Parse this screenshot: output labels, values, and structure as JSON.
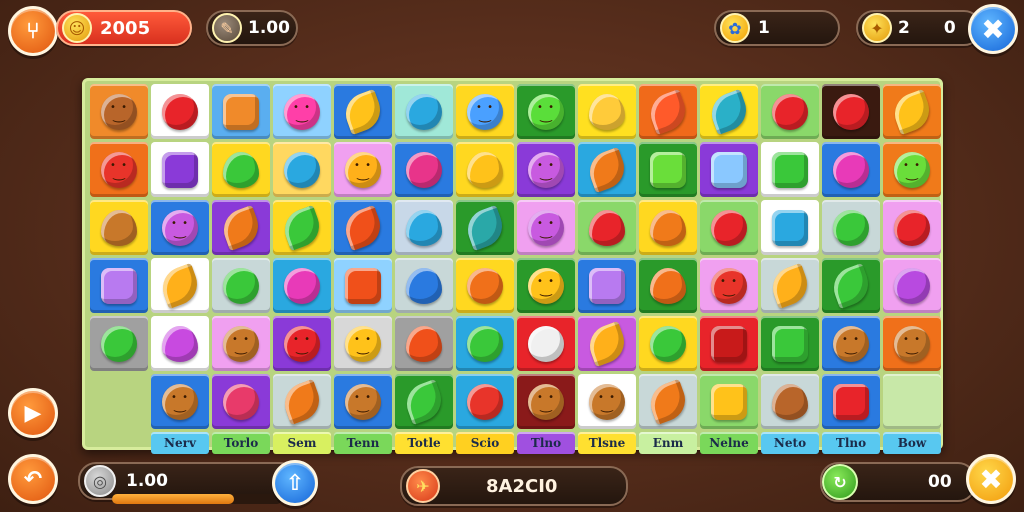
{
  "hud": {
    "score": "2005",
    "boosters": "1.00",
    "lives": "1",
    "coins_left": "2",
    "coins_right": "0",
    "bottom_left_value": "1.00",
    "center_code": "8A2CI0",
    "bottom_right_value": "00",
    "progress_fraction": 0.72
  },
  "colors": {
    "accent": "#e0560f",
    "board_border": "#d7ec9c",
    "background": "#5a2f1d"
  },
  "icons": {
    "top_left": "menu-icon",
    "score": "coin-face-icon",
    "booster": "pencil-icon",
    "lives": "paw-icon",
    "coins": "coin-icon",
    "close": "close-x-icon",
    "play": "play-icon",
    "back": "back-arrow-icon",
    "shield": "shield-icon",
    "upload": "upload-icon",
    "center": "rocket-icon",
    "refresh": "refresh-icon",
    "bottom_close": "close-x-icon"
  },
  "board": {
    "rows": [
      [
        {
          "bg": "#f08a2a",
          "color": "#b8652a",
          "shape": "face"
        },
        {
          "bg": "#ffffff",
          "color": "#e8242a",
          "shape": "round"
        },
        {
          "bg": "#5aaef0",
          "color": "#f08a2a",
          "shape": "sq"
        },
        {
          "bg": "#8fd2ff",
          "color": "#ff3fa8",
          "shape": "face"
        },
        {
          "bg": "#2a7ae0",
          "color": "#ffc21a",
          "shape": "leaf"
        },
        {
          "bg": "#a0e8d8",
          "color": "#2aa8e0",
          "shape": "round"
        },
        {
          "bg": "#ffd820",
          "color": "#4aa0ff",
          "shape": "face"
        },
        {
          "bg": "#2a9a2a",
          "color": "#5ade3a",
          "shape": "face"
        },
        {
          "bg": "#ffe020",
          "color": "#ffcb3a",
          "shape": "drop"
        },
        {
          "bg": "#f06a1a",
          "color": "#ff5a2a",
          "shape": "leaf"
        },
        {
          "bg": "#ffe020",
          "color": "#2ab0c8",
          "shape": "leaf"
        },
        {
          "bg": "#8ad86a",
          "color": "#e8242a",
          "shape": "round"
        },
        {
          "bg": "#3a1a10",
          "color": "#e8242a",
          "shape": "round"
        },
        {
          "bg": "#f07a1a",
          "color": "#ffc21a",
          "shape": "leaf"
        }
      ],
      [
        {
          "bg": "#f0701a",
          "color": "#e8342a",
          "shape": "face"
        },
        {
          "bg": "#ffffff",
          "color": "#8a3ad8",
          "shape": "sq"
        },
        {
          "bg": "#ffd820",
          "color": "#3ac83a",
          "shape": "drop"
        },
        {
          "bg": "#ffd860",
          "color": "#2aa8e0",
          "shape": "round"
        },
        {
          "bg": "#f0a0f0",
          "color": "#ffb01a",
          "shape": "face"
        },
        {
          "bg": "#2a7ae0",
          "color": "#e8348a",
          "shape": "round"
        },
        {
          "bg": "#ffd820",
          "color": "#ffc21a",
          "shape": "drop"
        },
        {
          "bg": "#8a3ad8",
          "color": "#c85ae0",
          "shape": "face"
        },
        {
          "bg": "#2aa8e0",
          "color": "#f07a1a",
          "shape": "leaf"
        },
        {
          "bg": "#2a9a2a",
          "color": "#6ade3a",
          "shape": "sq"
        },
        {
          "bg": "#8a3ad8",
          "color": "#8ac8ff",
          "shape": "sq"
        },
        {
          "bg": "#ffffff",
          "color": "#3ac83a",
          "shape": "sq"
        },
        {
          "bg": "#2a7ae0",
          "color": "#e83ab8",
          "shape": "round"
        },
        {
          "bg": "#f07a1a",
          "color": "#6ade3a",
          "shape": "face"
        }
      ],
      [
        {
          "bg": "#ffd820",
          "color": "#c8782a",
          "shape": "drop"
        },
        {
          "bg": "#2a7ae0",
          "color": "#c85ae0",
          "shape": "face"
        },
        {
          "bg": "#8a3ad8",
          "color": "#f07a1a",
          "shape": "leaf"
        },
        {
          "bg": "#ffd820",
          "color": "#3ac83a",
          "shape": "leaf"
        },
        {
          "bg": "#2a7ae0",
          "color": "#f0501a",
          "shape": "leaf"
        },
        {
          "bg": "#c8d8e8",
          "color": "#2aa8e0",
          "shape": "drop"
        },
        {
          "bg": "#2a9a2a",
          "color": "#2aa8a8",
          "shape": "leaf"
        },
        {
          "bg": "#f0a0f0",
          "color": "#c85ae0",
          "shape": "face"
        },
        {
          "bg": "#8ad86a",
          "color": "#e8242a",
          "shape": "drop"
        },
        {
          "bg": "#ffd820",
          "color": "#f07a1a",
          "shape": "drop"
        },
        {
          "bg": "#8ad86a",
          "color": "#e8242a",
          "shape": "round"
        },
        {
          "bg": "#ffffff",
          "color": "#2aa8e0",
          "shape": "sq"
        },
        {
          "bg": "#c8d8d8",
          "color": "#3ac83a",
          "shape": "round"
        },
        {
          "bg": "#f0a0f0",
          "color": "#e8242a",
          "shape": "round"
        }
      ],
      [
        {
          "bg": "#2a7ae0",
          "color": "#b87af0",
          "shape": "sq"
        },
        {
          "bg": "#ffffff",
          "color": "#ffb01a",
          "shape": "leaf"
        },
        {
          "bg": "#c8d8d8",
          "color": "#3ac83a",
          "shape": "round"
        },
        {
          "bg": "#2aa8e0",
          "color": "#e83ab8",
          "shape": "round"
        },
        {
          "bg": "#8fd2ff",
          "color": "#f0501a",
          "shape": "sq"
        },
        {
          "bg": "#c8d8d8",
          "color": "#2a7ae0",
          "shape": "drop"
        },
        {
          "bg": "#ffd820",
          "color": "#f0701a",
          "shape": "round"
        },
        {
          "bg": "#2a9a2a",
          "color": "#ffc21a",
          "shape": "face"
        },
        {
          "bg": "#2a7ae0",
          "color": "#b87af0",
          "shape": "sq"
        },
        {
          "bg": "#2a9a2a",
          "color": "#f0701a",
          "shape": "drop"
        },
        {
          "bg": "#f0a0f0",
          "color": "#e8342a",
          "shape": "face"
        },
        {
          "bg": "#c8d8d8",
          "color": "#ffb01a",
          "shape": "leaf"
        },
        {
          "bg": "#2a9a2a",
          "color": "#3ac83a",
          "shape": "leaf"
        },
        {
          "bg": "#f0a0f0",
          "color": "#b84ae0",
          "shape": "round"
        }
      ],
      [
        {
          "bg": "#a0a0a0",
          "color": "#3ac83a",
          "shape": "round"
        },
        {
          "bg": "#ffffff",
          "color": "#c84ae0",
          "shape": "drop"
        },
        {
          "bg": "#f0a0f0",
          "color": "#c8782a",
          "shape": "face"
        },
        {
          "bg": "#8a3ad8",
          "color": "#e8242a",
          "shape": "face"
        },
        {
          "bg": "#d8d8d8",
          "color": "#ffc21a",
          "shape": "face"
        },
        {
          "bg": "#a0a0a0",
          "color": "#f0501a",
          "shape": "drop"
        },
        {
          "bg": "#2aa8e0",
          "color": "#3ac83a",
          "shape": "round"
        },
        {
          "bg": "#e8242a",
          "color": "#f0f0f0",
          "shape": "round"
        },
        {
          "bg": "#c85ae0",
          "color": "#ffb01a",
          "shape": "leaf"
        },
        {
          "bg": "#ffd820",
          "color": "#3ac83a",
          "shape": "round"
        },
        {
          "bg": "#e8242a",
          "color": "#c81a1a",
          "shape": "sq"
        },
        {
          "bg": "#2a9a2a",
          "color": "#3ac83a",
          "shape": "sq"
        },
        {
          "bg": "#2a7ae0",
          "color": "#c8782a",
          "shape": "face"
        },
        {
          "bg": "#f0701a",
          "color": "#c8782a",
          "shape": "face"
        }
      ],
      [
        {
          "bg": "empty",
          "color": "",
          "shape": ""
        },
        {
          "bg": "#2a7ae0",
          "color": "#c8782a",
          "shape": "face"
        },
        {
          "bg": "#8a3ad8",
          "color": "#e83a6a",
          "shape": "round"
        },
        {
          "bg": "#c8d8d8",
          "color": "#f07a1a",
          "shape": "leaf"
        },
        {
          "bg": "#2a7ae0",
          "color": "#c8782a",
          "shape": "face"
        },
        {
          "bg": "#2a9a2a",
          "color": "#3ac83a",
          "shape": "leaf"
        },
        {
          "bg": "#2aa8e0",
          "color": "#e8342a",
          "shape": "round"
        },
        {
          "bg": "#8a1a1a",
          "color": "#c8782a",
          "shape": "face"
        },
        {
          "bg": "#ffffff",
          "color": "#c8782a",
          "shape": "face"
        },
        {
          "bg": "#c8d8d8",
          "color": "#f07a1a",
          "shape": "leaf"
        },
        {
          "bg": "#8ad86a",
          "color": "#ffc21a",
          "shape": "sq"
        },
        {
          "bg": "#c8d8d8",
          "color": "#b8652a",
          "shape": "drop"
        },
        {
          "bg": "#2a7ae0",
          "color": "#e8242a",
          "shape": "sq"
        },
        {
          "bg": "#c8e8a8",
          "color": "",
          "shape": ""
        }
      ]
    ],
    "labels": [
      {
        "text": "",
        "bg": "empty"
      },
      {
        "text": "Nerv",
        "bg": "#58c8f0"
      },
      {
        "text": "Torlo",
        "bg": "#7ad85a"
      },
      {
        "text": "Sem",
        "bg": "#d8f060"
      },
      {
        "text": "Tenn",
        "bg": "#7ad85a"
      },
      {
        "text": "Totle",
        "bg": "#ffe030"
      },
      {
        "text": "Scio",
        "bg": "#ffd020"
      },
      {
        "text": "Tlno",
        "bg": "#a050e0"
      },
      {
        "text": "Tlsne",
        "bg": "#ffe030"
      },
      {
        "text": "Enm",
        "bg": "#c8f0a0"
      },
      {
        "text": "Nelne",
        "bg": "#7ad85a"
      },
      {
        "text": "Neto",
        "bg": "#58c8f0"
      },
      {
        "text": "Tlno",
        "bg": "#58c8f0"
      },
      {
        "text": "Bow",
        "bg": "#58c8f0"
      }
    ]
  }
}
